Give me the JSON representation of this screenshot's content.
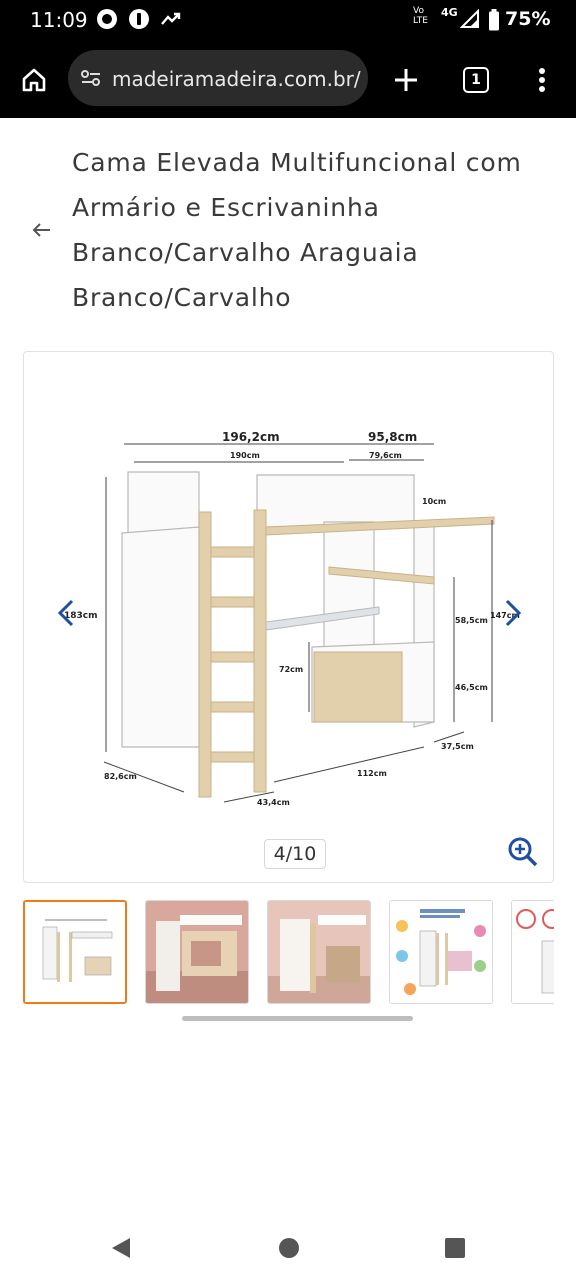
{
  "status_bar": {
    "time": "11:09",
    "network_top": "Vo",
    "network_bottom": "LTE",
    "network_type": "4G",
    "battery_percent": "75%",
    "icons": [
      "whatsapp-icon",
      "shield-icon",
      "trending-icon",
      "signal-icon",
      "battery-icon"
    ]
  },
  "browser": {
    "url": "madeiramadeira.com.br/",
    "tab_count": "1",
    "icons": [
      "home-icon",
      "site-settings-icon",
      "new-tab-icon",
      "tab-switcher-icon",
      "menu-icon"
    ]
  },
  "product": {
    "title": "Cama Elevada Multifuncional com Armário e Escrivaninha Branco/Carvalho Araguaia Branco/Carvalho"
  },
  "gallery": {
    "counter": "4/10",
    "dimensions": {
      "total_width": "196,2cm",
      "bed_length": "190cm",
      "top_depth": "95,8cm",
      "inner_depth": "79,6cm",
      "rail_height": "10cm",
      "total_height": "183cm",
      "side_height": "147cm",
      "shelf_gap": "58,5cm",
      "desk_height": "72cm",
      "cabinet_height": "46,5cm",
      "base_depth": "37,5cm",
      "desk_length": "112cm",
      "wardrobe_depth": "82,6cm",
      "ladder_width": "43,4cm"
    },
    "thumbnails": [
      {
        "name": "thumb-dimensions",
        "selected": true
      },
      {
        "name": "thumb-room-pink",
        "selected": false
      },
      {
        "name": "thumb-room-wardrobe",
        "selected": false
      },
      {
        "name": "thumb-features",
        "selected": false
      },
      {
        "name": "thumb-measurements",
        "selected": false
      }
    ]
  },
  "colors": {
    "accent_orange": "#f07a1c",
    "link_blue": "#1f4fa3",
    "wood": "#d9c4a0",
    "chrome_black": "#000000"
  }
}
